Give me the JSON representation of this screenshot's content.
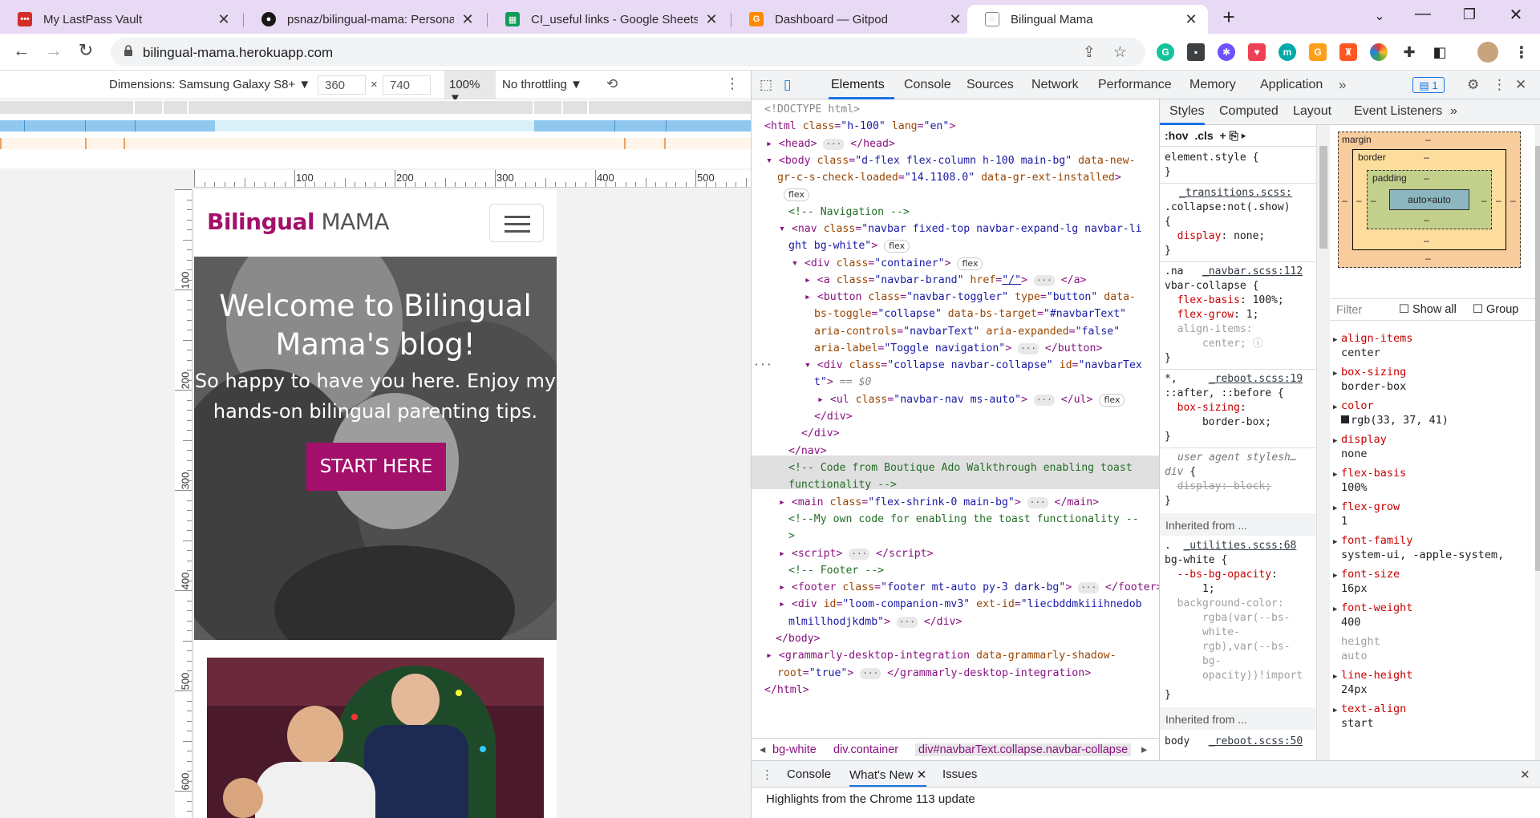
{
  "browser": {
    "tabs": [
      {
        "title": "My LastPass Vault",
        "icon": "lastpass-icon",
        "color": "#d32d27"
      },
      {
        "title": "psnaz/bilingual-mama: Personal",
        "icon": "github-icon",
        "color": "#181717"
      },
      {
        "title": "CI_useful links - Google Sheets",
        "icon": "google-sheets-icon",
        "color": "#0f9d58"
      },
      {
        "title": "Dashboard — Gitpod",
        "icon": "gitpod-icon",
        "color": "#ff8a00"
      },
      {
        "title": "Bilingual Mama",
        "icon": "page-icon",
        "color": "#888888"
      }
    ],
    "url": "bilingual-mama.herokuapp.com"
  },
  "device_toolbar": {
    "dimensions_label": "Dimensions: Samsung Galaxy S8+",
    "width": "360",
    "height": "740",
    "times": "×",
    "zoom": "100%",
    "throttling": "No throttling"
  },
  "rulers": {
    "h_labels": [
      "100",
      "200",
      "300",
      "400",
      "500"
    ],
    "v_labels": [
      "100",
      "200",
      "300",
      "400",
      "500",
      "600"
    ]
  },
  "site": {
    "brand_bold": "Bilingual",
    "brand_light": " MAMA",
    "hero_title": "Welcome to Bilingual Mama's blog!",
    "hero_subtitle": "So happy to have you here. Enjoy my hands-on bilingual parenting tips.",
    "cta": "START HERE",
    "accent": "#a3106b"
  },
  "devtools": {
    "tabs": [
      "Elements",
      "Console",
      "Sources",
      "Network",
      "Performance",
      "Memory",
      "Application"
    ],
    "issues_count": "1",
    "style_tabs": [
      "Styles",
      "Computed",
      "Layout",
      "Event Listeners"
    ],
    "breadcrumbs": [
      "bg-white",
      "div.container",
      "div#navbarText.collapse.navbar-collapse"
    ],
    "drawer_tabs": [
      "Console",
      "What's New",
      "Issues"
    ],
    "drawer_text": "Highlights from the Chrome 113 update",
    "filter_placeholder": "Filter",
    "show_all": "Show all",
    "group": "Group",
    "hov": ":hov",
    "cls": ".cls",
    "inherited_label": "Inherited from ...",
    "box_model": {
      "margin": "margin",
      "border": "border",
      "padding": "padding",
      "content": "auto×auto",
      "dash": "–"
    },
    "computed": [
      {
        "name": "align-items",
        "value": "center"
      },
      {
        "name": "box-sizing",
        "value": "border-box"
      },
      {
        "name": "color",
        "value": "rgb(33, 37, 41)"
      },
      {
        "name": "display",
        "value": "none"
      },
      {
        "name": "flex-basis",
        "value": "100%"
      },
      {
        "name": "flex-grow",
        "value": "1"
      },
      {
        "name": "font-family",
        "value": "system-ui, -apple-system,"
      },
      {
        "name": "font-size",
        "value": "16px"
      },
      {
        "name": "font-weight",
        "value": "400"
      },
      {
        "name": "height",
        "value": "auto"
      },
      {
        "name": "line-height",
        "value": "24px"
      },
      {
        "name": "text-align",
        "value": "start"
      }
    ]
  }
}
